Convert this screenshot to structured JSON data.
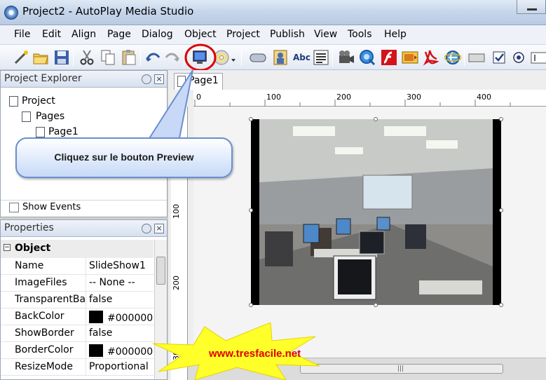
{
  "window": {
    "title": "Project2 - AutoPlay Media Studio"
  },
  "menu": [
    "File",
    "Edit",
    "Align",
    "Page",
    "Dialog",
    "Object",
    "Project",
    "Publish",
    "View",
    "Tools",
    "Help"
  ],
  "toolbar": {
    "text_button_label": "Abc"
  },
  "project_explorer": {
    "title": "Project Explorer",
    "tree": {
      "root": "Project",
      "pages": "Pages",
      "page1": "Page1"
    },
    "show_events_label": "Show Events",
    "show_events_checked": false
  },
  "properties": {
    "title": "Properties",
    "section": "Object",
    "rows": [
      {
        "name": "Name",
        "value": "SlideShow1"
      },
      {
        "name": "ImageFiles",
        "value": "-- None --"
      },
      {
        "name": "TransparentBackground",
        "value": "false"
      },
      {
        "name": "BackColor",
        "value": "#000000",
        "swatch": "#000000"
      },
      {
        "name": "ShowBorder",
        "value": "false"
      },
      {
        "name": "BorderColor",
        "value": "#000000",
        "swatch": "#000000"
      },
      {
        "name": "ResizeMode",
        "value": "Proportional"
      }
    ]
  },
  "editor": {
    "tab_label": "Page1",
    "ruler_top_labels": [
      "0",
      "100",
      "200",
      "300",
      "400"
    ],
    "ruler_left_labels": [
      "100",
      "200",
      "300"
    ]
  },
  "annotation": {
    "callout_text": "Cliquez sur le bouton Preview",
    "watermark": "www.tresfacile.net",
    "highlight_color": "#e00000"
  }
}
